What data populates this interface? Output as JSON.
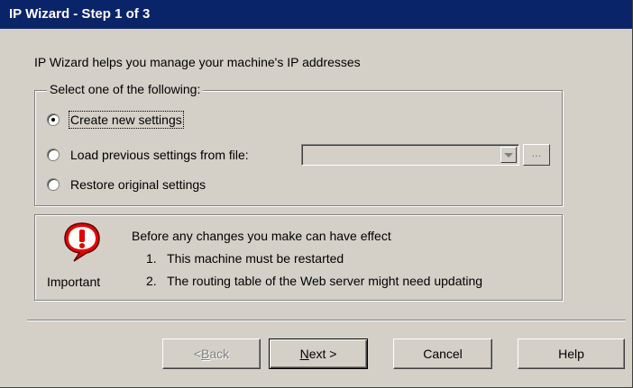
{
  "window": {
    "title": "IP Wizard - Step 1 of 3"
  },
  "intro_text": "IP Wizard helps you manage your machine's IP addresses",
  "options_group": {
    "legend": "Select one of the following:",
    "options": [
      {
        "label": "Create new settings",
        "selected": true
      },
      {
        "label": "Load previous settings from file:",
        "selected": false
      },
      {
        "label": "Restore original settings",
        "selected": false
      }
    ],
    "file_combo_value": "",
    "browse_label": "..."
  },
  "notice": {
    "icon": "exclamation-balloon-icon",
    "label": "Important",
    "heading": "Before any changes you make can have effect",
    "items": [
      {
        "num": "1.",
        "text": "This machine must be restarted"
      },
      {
        "num": "2.",
        "text": "The routing table of the Web server might need updating"
      }
    ]
  },
  "buttons": {
    "back": {
      "prefix": "< ",
      "mnemonic": "B",
      "rest": "ack",
      "enabled": false
    },
    "next": {
      "mnemonic": "N",
      "rest": "ext >"
    },
    "cancel": "Cancel",
    "help": "Help"
  }
}
